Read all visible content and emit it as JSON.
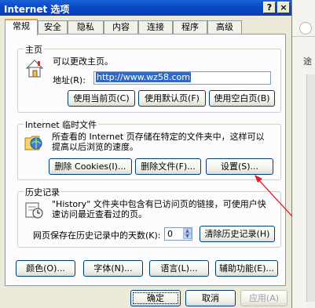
{
  "window": {
    "title": "Internet 选项",
    "help_btn": "?",
    "close_btn": "×"
  },
  "tabs": [
    {
      "label": "常规",
      "active": true
    },
    {
      "label": "安全"
    },
    {
      "label": "隐私"
    },
    {
      "label": "内容"
    },
    {
      "label": "连接"
    },
    {
      "label": "程序"
    },
    {
      "label": "高级"
    }
  ],
  "home": {
    "legend": "主页",
    "desc": "可以更改主页。",
    "address_label": "地址(R):",
    "address_value": "http://www.wz58.com",
    "btn_current": "使用当前页(C)",
    "btn_default": "使用默认页(F)",
    "btn_blank": "使用空白页(B)"
  },
  "temp": {
    "legend": "Internet 临时文件",
    "desc_line1": "所查看的 Internet 页存储在特定的文件夹中，这样可以",
    "desc_line2": "提高以后浏览的速度。",
    "btn_cookies": "删除 Cookies(I)...",
    "btn_files": "删除文件(F)...",
    "btn_settings": "设置(S)..."
  },
  "history": {
    "legend": "历史记录",
    "desc_line1": "\"History\" 文件夹中包含有已访问页的链接，可使用户快",
    "desc_line2": "速访问最近查看过的页。",
    "days_label": "网页保存在历史记录中的天数(K):",
    "days_value": "0",
    "btn_clear": "清除历史记录(H)"
  },
  "bottom_buttons": {
    "colors": "颜色(O)...",
    "fonts": "字体(N)...",
    "languages": "语言(L)...",
    "accessibility": "辅助功能(E)..."
  },
  "dialog_buttons": {
    "ok": "确定",
    "cancel": "取消",
    "apply": "应用(A)"
  },
  "background": {
    "glyph": "途"
  },
  "colors": {
    "titlebar": "#0a46c4",
    "dialog_bg": "#ece9d8",
    "panel_bg": "#fcfcfe",
    "selection": "#316ac5",
    "arrow": "#e02020"
  }
}
